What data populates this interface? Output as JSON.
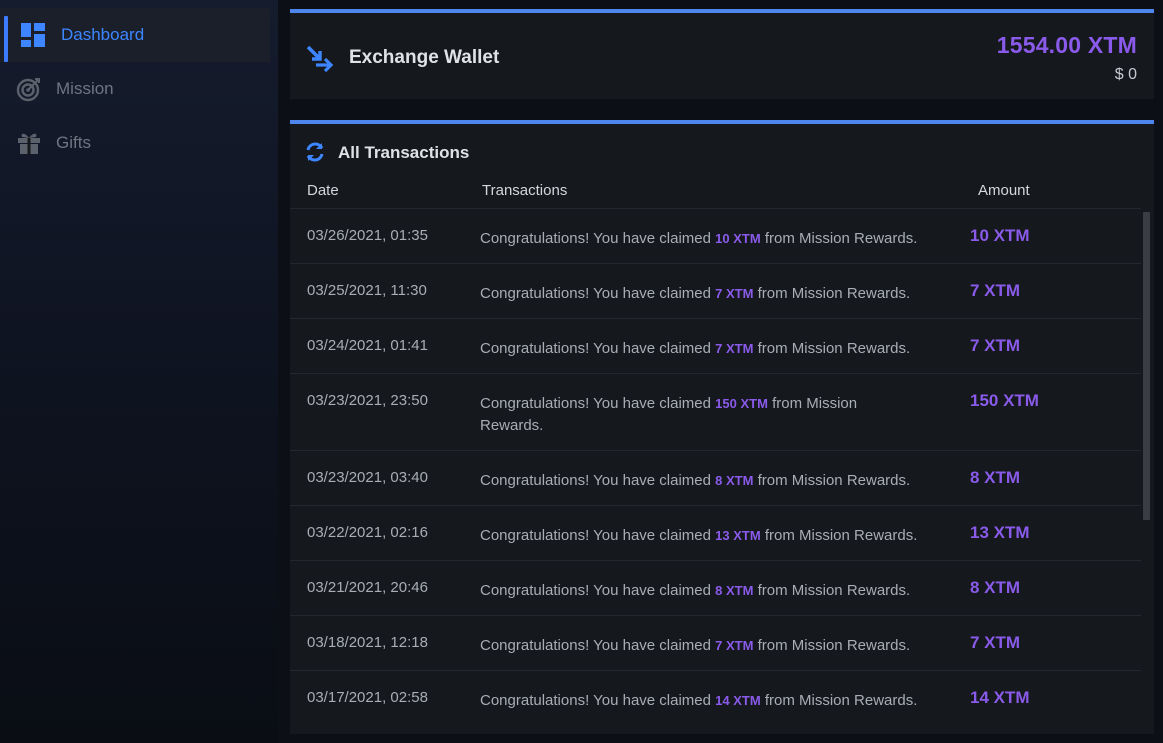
{
  "sidebar": {
    "items": [
      {
        "label": "Dashboard",
        "icon": "dashboard-icon",
        "active": true
      },
      {
        "label": "Mission",
        "icon": "target-icon",
        "active": false
      },
      {
        "label": "Gifts",
        "icon": "gift-icon",
        "active": false
      }
    ]
  },
  "wallet": {
    "title": "Exchange Wallet",
    "amount": "1554.00 XTM",
    "usd": "$ 0"
  },
  "transactions": {
    "title": "All Transactions",
    "columns": {
      "date": "Date",
      "tx": "Transactions",
      "amount": "Amount"
    },
    "rows": [
      {
        "date": "03/26/2021, 01:35",
        "pre": "Congratulations! You have claimed ",
        "hl": "10 XTM",
        "post": " from Mission Rewards.",
        "amount": "10 XTM"
      },
      {
        "date": "03/25/2021, 11:30",
        "pre": "Congratulations! You have claimed ",
        "hl": "7 XTM",
        "post": " from Mission Rewards.",
        "amount": "7 XTM"
      },
      {
        "date": "03/24/2021, 01:41",
        "pre": "Congratulations! You have claimed ",
        "hl": "7 XTM",
        "post": " from Mission Rewards.",
        "amount": "7 XTM"
      },
      {
        "date": "03/23/2021, 23:50",
        "pre": "Congratulations! You have claimed ",
        "hl": "150 XTM",
        "post": " from Mission Rewards.",
        "amount": "150 XTM"
      },
      {
        "date": "03/23/2021, 03:40",
        "pre": "Congratulations! You have claimed ",
        "hl": "8 XTM",
        "post": " from Mission Rewards.",
        "amount": "8 XTM"
      },
      {
        "date": "03/22/2021, 02:16",
        "pre": "Congratulations! You have claimed ",
        "hl": "13 XTM",
        "post": " from Mission Rewards.",
        "amount": "13 XTM"
      },
      {
        "date": "03/21/2021, 20:46",
        "pre": "Congratulations! You have claimed ",
        "hl": "8 XTM",
        "post": " from Mission Rewards.",
        "amount": "8 XTM"
      },
      {
        "date": "03/18/2021, 12:18",
        "pre": "Congratulations! You have claimed ",
        "hl": "7 XTM",
        "post": " from Mission Rewards.",
        "amount": "7 XTM"
      },
      {
        "date": "03/17/2021, 02:58",
        "pre": "Congratulations! You have claimed ",
        "hl": "14 XTM",
        "post": " from Mission Rewards.",
        "amount": "14 XTM"
      }
    ]
  },
  "colors": {
    "accent_blue": "#3d86ff",
    "accent_purple": "#8a5bea",
    "card_bg": "#15181d"
  }
}
